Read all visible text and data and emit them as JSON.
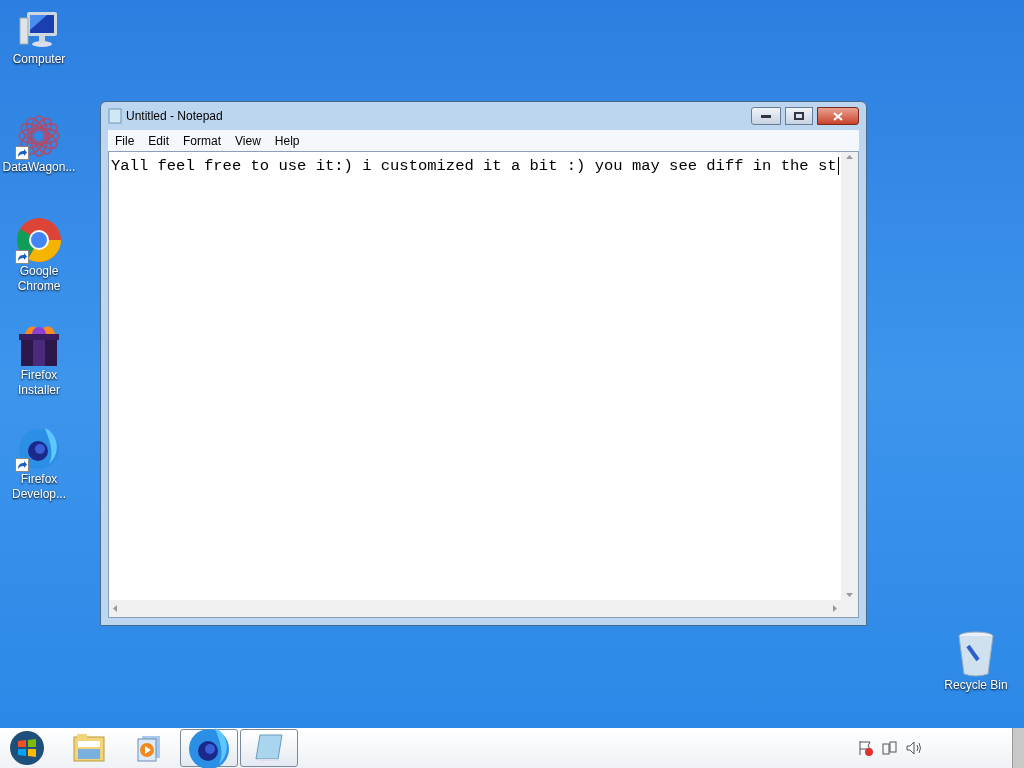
{
  "desktop_icons": [
    {
      "label": "Computer",
      "kind": "computer",
      "shortcut": false
    },
    {
      "label": "DataWagon...",
      "kind": "flower",
      "shortcut": true
    },
    {
      "label": "Google Chrome",
      "kind": "chrome",
      "shortcut": true
    },
    {
      "label": "Firefox Installer",
      "kind": "box",
      "shortcut": false
    },
    {
      "label": "Firefox Develop...",
      "kind": "firefox",
      "shortcut": true
    }
  ],
  "recycle_bin": {
    "label": "Recycle Bin"
  },
  "window": {
    "title": "Untitled - Notepad",
    "menu": [
      "File",
      "Edit",
      "Format",
      "View",
      "Help"
    ],
    "text": "Yall feel free to use it:) i customized it a bit :) you may see diff in the st"
  },
  "taskbar": {
    "items": [
      {
        "kind": "folder",
        "open": false
      },
      {
        "kind": "player",
        "open": false
      },
      {
        "kind": "firefox",
        "open": true
      },
      {
        "kind": "notepad",
        "open": true
      }
    ]
  }
}
